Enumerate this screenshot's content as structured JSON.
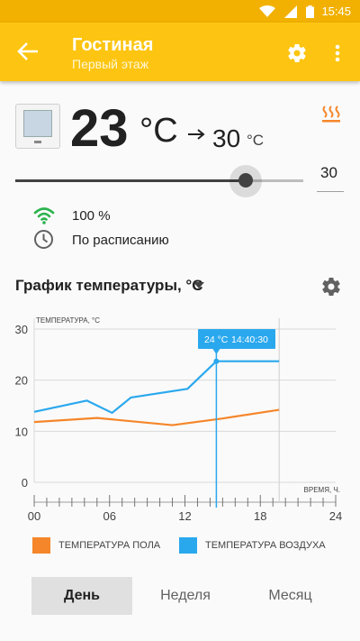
{
  "status_bar": {
    "time": "15:45",
    "icons": [
      "wifi-icon",
      "signal-icon",
      "battery-icon"
    ]
  },
  "app_bar": {
    "title": "Гостиная",
    "subtitle": "Первый этаж",
    "icons": [
      "back-arrow-icon",
      "gear-icon",
      "more-vert-icon"
    ]
  },
  "thermostat": {
    "current_temp": "23",
    "current_unit": "°C",
    "target_temp": "30",
    "target_unit": "°C",
    "setpoint_value": "30",
    "setpoint_fraction": 0.8,
    "signal_strength": "100 %",
    "mode": "По расписанию",
    "heating_icon": "heating-icon"
  },
  "graph": {
    "title": "График температуры, °C"
  },
  "colors": {
    "accent": "#fdc511",
    "status_bar": "#f2b100",
    "floor_series": "#f5862a",
    "air_series": "#2aa8ee",
    "wifi": "#2bb24c"
  },
  "chart_data": {
    "type": "line",
    "ylabel": "ТЕМПЕРАТУРА, °C",
    "xlabel": "ВРЕМЯ, Ч.",
    "xlim": [
      0,
      24
    ],
    "ylim": [
      0,
      30
    ],
    "x_ticks": [
      "00",
      "06",
      "12",
      "18",
      "24"
    ],
    "y_ticks": [
      "0",
      "10",
      "20",
      "30"
    ],
    "grid": true,
    "legend_position": "bottom",
    "series": [
      {
        "name": "ТЕМПЕРАТУРА ПОЛА",
        "color": "#f5862a",
        "x": [
          0,
          5,
          11,
          15,
          19.5
        ],
        "y": [
          11.8,
          12.6,
          11.2,
          12.5,
          14.2
        ]
      },
      {
        "name": "ТЕМПЕРАТУРА ВОЗДУХА",
        "color": "#2aa8ee",
        "x": [
          0,
          4.2,
          6.2,
          7.7,
          12.2,
          14.5,
          19.5
        ],
        "y": [
          13.8,
          16,
          13.6,
          16.6,
          18.3,
          23.7,
          23.7
        ]
      }
    ],
    "tooltip": {
      "x": 14.5,
      "value": "24 °C",
      "time": "14:40:30"
    },
    "marker_x": 19.5
  },
  "tabs": [
    {
      "label": "День",
      "active": true
    },
    {
      "label": "Неделя",
      "active": false
    },
    {
      "label": "Месяц",
      "active": false
    }
  ]
}
